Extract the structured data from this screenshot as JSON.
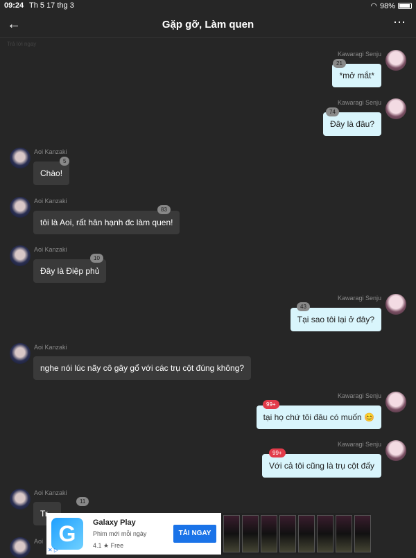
{
  "status_bar": {
    "time": "09:24",
    "date": "Th 5 17 thg 3",
    "battery": "98%"
  },
  "header": {
    "back_icon": "←",
    "title": "Gặp gỡ, Làm quen",
    "more_icon": "⋯"
  },
  "faint_label": "Trả lời ngay",
  "messages": [
    {
      "sender": "Kawaragi Senju",
      "text": "*mở mắt*",
      "badge": "21",
      "side": "right"
    },
    {
      "sender": "Kawaragi Senju",
      "text": "Đây là đâu?",
      "badge": "74",
      "side": "right"
    },
    {
      "sender": "Aoi Kanzaki",
      "text": "Chào!",
      "badge": "5",
      "side": "left"
    },
    {
      "sender": "Aoi Kanzaki",
      "text": "tôi là Aoi, rất hân hạnh đc làm quen!",
      "badge": "83",
      "side": "left"
    },
    {
      "sender": "Aoi Kanzaki",
      "text": "Đây là Điệp phủ",
      "badge": "10",
      "side": "left"
    },
    {
      "sender": "Kawaragi Senju",
      "text": "Tại sao tôi lại ở đây?",
      "badge": "43",
      "side": "right"
    },
    {
      "sender": "Aoi Kanzaki",
      "text": "nghe nói lúc nãy cô gây gổ với các trụ cột đúng không?",
      "badge": "",
      "side": "left"
    },
    {
      "sender": "Kawaragi Senju",
      "text": "tại họ chứ tôi đâu có muốn 😊",
      "badge": "99+",
      "side": "right"
    },
    {
      "sender": "Kawaragi Senju",
      "text": "Với cả tôi cũng là trụ cột đấy",
      "badge": "99+",
      "side": "right"
    },
    {
      "sender": "Aoi Kanzaki",
      "text": "Tr...",
      "badge": "11",
      "side": "left"
    }
  ],
  "bottom_sender": "Aoi",
  "ad": {
    "logo_letter": "G",
    "app_name": "Galaxy Play",
    "tagline": "Phim mới mỗi ngày",
    "rating": "4.1 ★  Free",
    "cta": "TẢI NGAY",
    "adchoices": "✕ ▷"
  }
}
